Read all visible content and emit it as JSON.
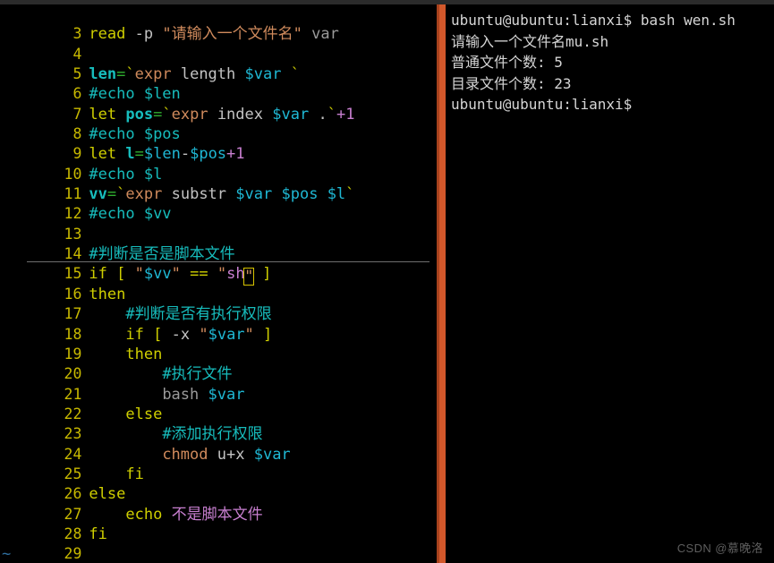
{
  "window": {
    "top_strip_color": "#2b2b2b",
    "divider_color": "#d2582b",
    "background": "#000000"
  },
  "editor": {
    "name": "vim",
    "cursor_line_number": 15,
    "tilde_marker": "~",
    "lines": [
      {
        "num": "3",
        "text": "read -p \"请输入一个文件名\" var"
      },
      {
        "num": "4",
        "text": ""
      },
      {
        "num": "5",
        "text": "len=`expr length $var `"
      },
      {
        "num": "6",
        "text": "#echo $len"
      },
      {
        "num": "7",
        "text": "let pos=`expr index $var .`+1"
      },
      {
        "num": "8",
        "text": "#echo $pos"
      },
      {
        "num": "9",
        "text": "let l=$len-$pos+1"
      },
      {
        "num": "10",
        "text": "#echo $l"
      },
      {
        "num": "11",
        "text": "vv=`expr substr $var $pos $l`"
      },
      {
        "num": "12",
        "text": "#echo $vv"
      },
      {
        "num": "13",
        "text": ""
      },
      {
        "num": "14",
        "text": "#判断是否是脚本文件"
      },
      {
        "num": "15",
        "text": "if [ \"$vv\" == \"sh\" ]"
      },
      {
        "num": "16",
        "text": "then"
      },
      {
        "num": "17",
        "text": "    #判断是否有执行权限"
      },
      {
        "num": "18",
        "text": "    if [ -x \"$var\" ]"
      },
      {
        "num": "19",
        "text": "    then"
      },
      {
        "num": "20",
        "text": "        #执行文件"
      },
      {
        "num": "21",
        "text": "        bash $var"
      },
      {
        "num": "22",
        "text": "    else"
      },
      {
        "num": "23",
        "text": "        #添加执行权限"
      },
      {
        "num": "24",
        "text": "        chmod u+x $var"
      },
      {
        "num": "25",
        "text": "    fi"
      },
      {
        "num": "26",
        "text": "else"
      },
      {
        "num": "27",
        "text": "    echo 不是脚本文件"
      },
      {
        "num": "28",
        "text": "fi"
      },
      {
        "num": "29",
        "text": ""
      }
    ],
    "tokens": {
      "l3": {
        "kw": "read",
        "opt": "-p",
        "str": "\"请输入一个文件名\"",
        "arg": "var"
      },
      "l5": {
        "var": "len",
        "eq": "=",
        "tick1": "`",
        "cmd": "expr",
        "sub": "length",
        "param": "$var",
        "tick2": "`"
      },
      "l6": {
        "comment": "#echo $len"
      },
      "l7": {
        "kw": "let",
        "var": "pos",
        "eq": "=",
        "tick1": "`",
        "cmd": "expr",
        "sub": "index",
        "param": "$var",
        "dot": ".",
        "tick2": "`",
        "num": "+1"
      },
      "l8": {
        "comment": "#echo $pos"
      },
      "l9": {
        "kw": "let",
        "var": "l",
        "eq": "=",
        "expr_a": "$len",
        "minus": "-",
        "expr_b": "$pos",
        "num": "+1"
      },
      "l10": {
        "comment": "#echo $l"
      },
      "l11": {
        "var": "vv",
        "eq": "=",
        "tick1": "`",
        "cmd": "expr",
        "sub": "substr",
        "p1": "$var",
        "p2": "$pos",
        "p3": "$l",
        "tick2": "`"
      },
      "l12": {
        "comment": "#echo $vv"
      },
      "l14": {
        "comment": "#判断是否是脚本文件"
      },
      "l15": {
        "kw": "if",
        "br1": "[",
        "q1": "\"",
        "v1": "$vv",
        "q2": "\"",
        "op": "==",
        "q3": "\"",
        "v2": "sh",
        "cursor": "\"",
        "br2": "]"
      },
      "l16": {
        "kw": "then"
      },
      "l17": {
        "comment": "#判断是否有执行权限"
      },
      "l18": {
        "kw": "if",
        "br1": "[",
        "opt": "-x",
        "q1": "\"",
        "v1": "$var",
        "q2": "\"",
        "br2": "]"
      },
      "l19": {
        "kw": "then"
      },
      "l20": {
        "comment": "#执行文件"
      },
      "l21": {
        "cmd": "bash",
        "param": "$var"
      },
      "l22": {
        "kw": "else"
      },
      "l23": {
        "comment": "#添加执行权限"
      },
      "l24": {
        "cmd": "chmod",
        "mode": "u+x",
        "param": "$var"
      },
      "l25": {
        "kw": "fi"
      },
      "l26": {
        "kw": "else"
      },
      "l27": {
        "kw": "echo",
        "arg": "不是脚本文件"
      },
      "l28": {
        "kw": "fi"
      }
    }
  },
  "terminal": {
    "lines": [
      "ubuntu@ubuntu:lianxi$ bash wen.sh",
      "请输入一个文件名mu.sh",
      "普通文件个数: 5",
      "目录文件个数: 23",
      "ubuntu@ubuntu:lianxi$"
    ],
    "prompt": "ubuntu@ubuntu:lianxi$",
    "command": "bash wen.sh",
    "input_prompt": "请输入一个文件名",
    "input_value": "mu.sh",
    "result_regular_files_label": "普通文件个数:",
    "result_regular_files_count": "5",
    "result_dir_files_label": "目录文件个数:",
    "result_dir_files_count": "23"
  },
  "watermark": {
    "text": "CSDN @慕晚洛"
  }
}
